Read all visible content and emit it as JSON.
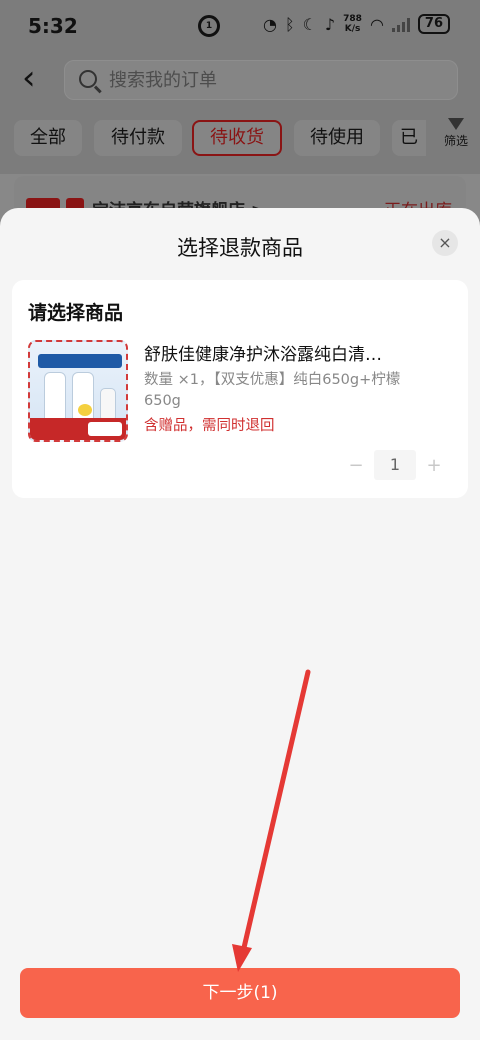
{
  "status_bar": {
    "time": "5:32",
    "center_badge": "1",
    "net_speed_value": "788",
    "net_speed_unit": "K/s",
    "battery": "76"
  },
  "background": {
    "search_placeholder": "搜索我的订单",
    "tabs": [
      "全部",
      "待付款",
      "待收货",
      "待使用",
      "已"
    ],
    "active_tab": "待收货",
    "filter_label": "筛选",
    "store_name": "宝洁京东自营旗舰店 >",
    "store_status": "正在出库"
  },
  "sheet": {
    "title": "选择退款商品",
    "close_icon": "×",
    "card": {
      "heading": "请选择商品",
      "product_name": "舒肤佳健康净护沐浴露纯白清…",
      "product_spec": "数量 ×1，【双支优惠】纯白650g+柠檬650g",
      "gift_note": "含赠品，需同时退回",
      "quantity": "1",
      "minus": "−",
      "plus": "+"
    },
    "next_button": "下一步(1)"
  },
  "colors": {
    "accent": "#f8644c",
    "gift_red": "#d03030",
    "arrow": "#e53935"
  }
}
